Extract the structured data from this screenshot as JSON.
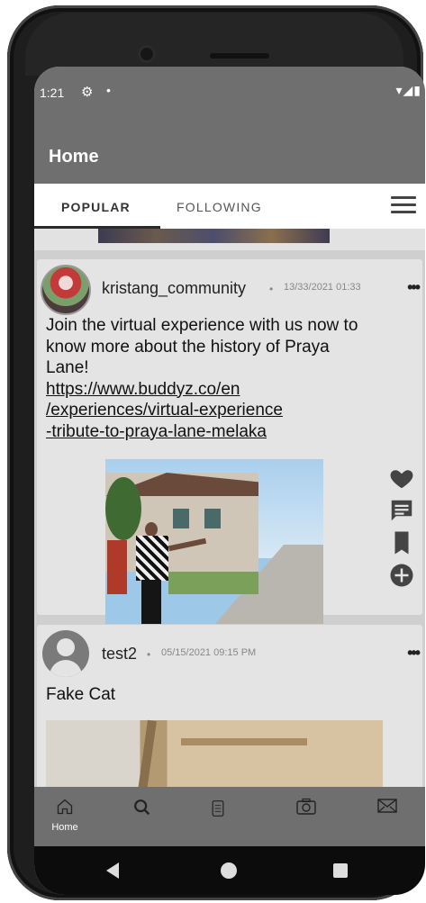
{
  "status_bar": {
    "time": "1:21",
    "settings_icon": "gear-icon",
    "signal_text": "▾◢▮"
  },
  "app_bar": {
    "title": "Home"
  },
  "tabs": [
    {
      "label": "POPULAR",
      "active": true
    },
    {
      "label": "FOLLOWING",
      "active": false
    }
  ],
  "posts": [
    {
      "username": "kristang_community",
      "separator": "•",
      "timestamp": "13/33/2021 01:33",
      "more": "•••",
      "text": "Join the virtual experience with us now to know more about the history of Praya Lane!",
      "link_lines": [
        "https://www.buddyz.co/en",
        "/experiences/virtual-experience",
        "-tribute-to-praya-lane-melaka"
      ]
    },
    {
      "username": "test2",
      "separator": "•",
      "timestamp": "05/15/2021 09:15 PM",
      "more": "•••",
      "text": "Fake Cat"
    }
  ],
  "post_actions": [
    "heart-icon",
    "comment-icon",
    "bookmark-icon",
    "add-icon"
  ],
  "bottom_nav": [
    {
      "icon": "home-icon",
      "label": "Home"
    },
    {
      "icon": "search-icon",
      "label": ""
    },
    {
      "icon": "notebook-icon",
      "label": ""
    },
    {
      "icon": "camera-icon",
      "label": ""
    },
    {
      "icon": "mail-icon",
      "label": ""
    }
  ],
  "colors": {
    "bar": "#6f6f6f",
    "card": "#e4e4e4",
    "background": "#cfcfcf"
  }
}
